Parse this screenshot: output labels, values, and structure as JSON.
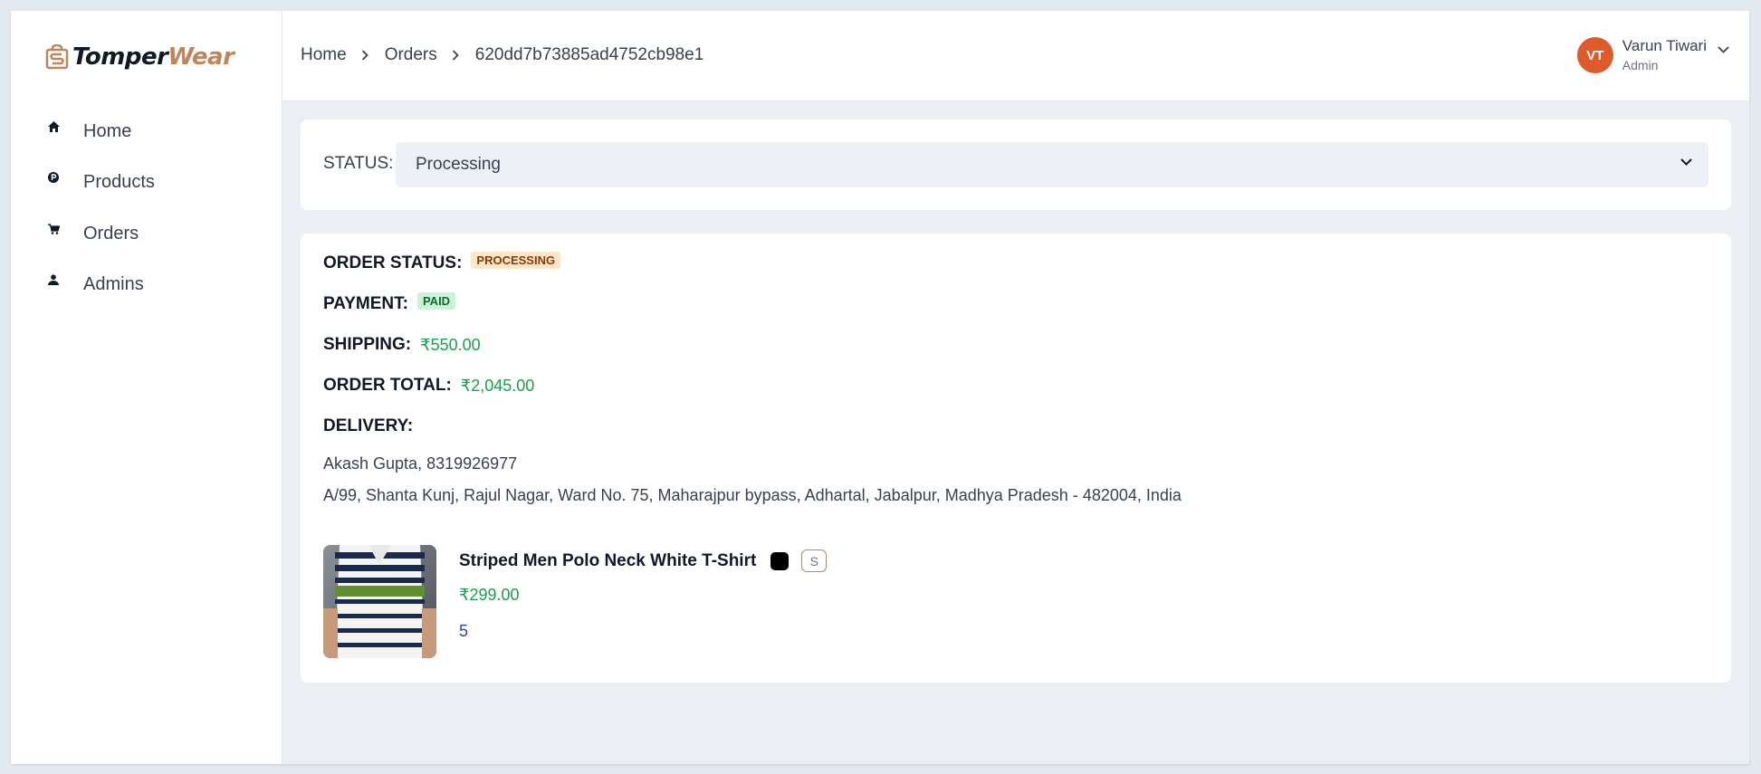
{
  "brand": {
    "name_a": "Tomper",
    "name_b": "Wear",
    "accent": "#c0855c"
  },
  "sidebar": {
    "items": [
      {
        "label": "Home",
        "icon": "home-icon"
      },
      {
        "label": "Products",
        "icon": "product-icon"
      },
      {
        "label": "Orders",
        "icon": "cart-icon"
      },
      {
        "label": "Admins",
        "icon": "user-icon"
      }
    ]
  },
  "header": {
    "breadcrumb": [
      "Home",
      "Orders",
      "620dd7b73885ad4752cb98e1"
    ],
    "user": {
      "initials": "VT",
      "name": "Varun Tiwari",
      "role": "Admin",
      "avatar_color": "#df5a2a"
    }
  },
  "status": {
    "label": "STATUS:",
    "selected": "Processing"
  },
  "order": {
    "status_label": "ORDER STATUS:",
    "status_badge": "PROCESSING",
    "payment_label": "PAYMENT:",
    "payment_badge": "PAID",
    "shipping_label": "SHIPPING:",
    "shipping_value": "₹550.00",
    "total_label": "ORDER TOTAL:",
    "total_value": "₹2,045.00",
    "delivery_label": "DELIVERY:",
    "delivery_contact": "Akash Gupta, 8319926977",
    "delivery_address": "A/99, Shanta Kunj, Rajul Nagar, Ward No. 75, Maharajpur bypass, Adhartal, Jabalpur, Madhya Pradesh - 482004, India"
  },
  "item": {
    "name": "Striped Men Polo Neck White T-Shirt",
    "color": "#000000",
    "size": "S",
    "price": "₹299.00",
    "quantity": "5"
  }
}
